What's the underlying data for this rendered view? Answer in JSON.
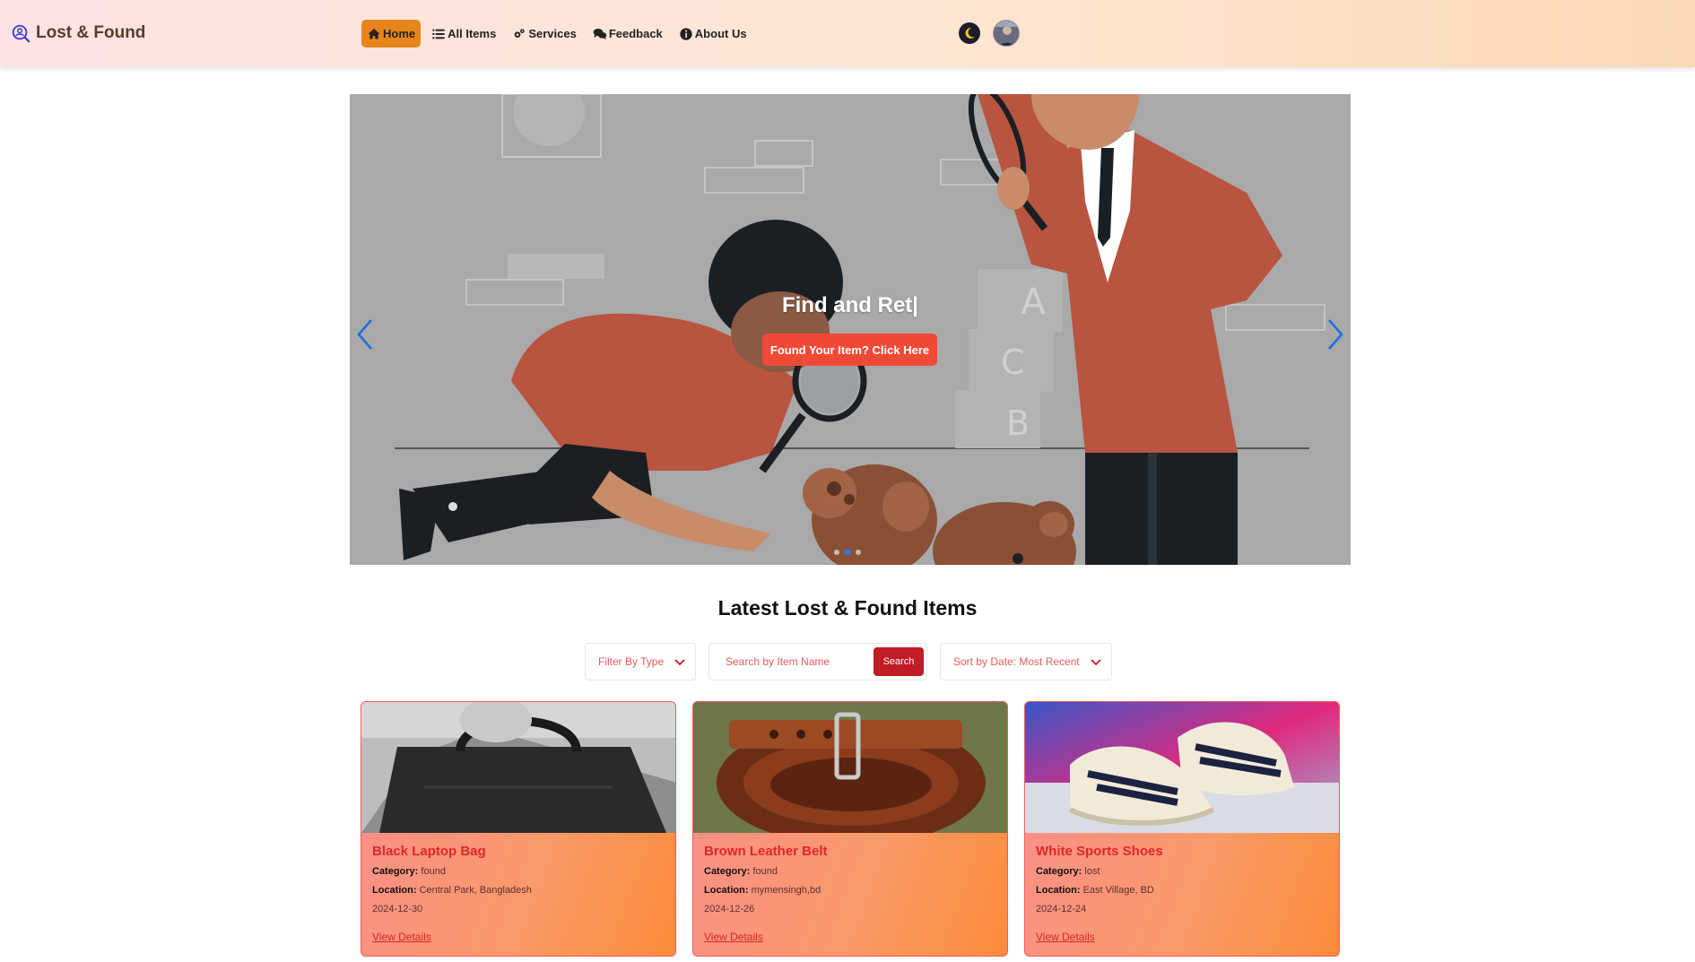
{
  "app": {
    "brand": "Lost & Found",
    "colors": {
      "accent": "#e8851a",
      "cta": "#f04a37",
      "danger": "#c01c24",
      "title_red": "#e0262c"
    }
  },
  "nav": {
    "items": [
      {
        "label": "Home",
        "icon": "home-icon",
        "active": true
      },
      {
        "label": "All Items",
        "icon": "list-icon",
        "active": false
      },
      {
        "label": "Services",
        "icon": "gears-icon",
        "active": false
      },
      {
        "label": "Feedback",
        "icon": "comments-icon",
        "active": false
      },
      {
        "label": "About Us",
        "icon": "info-icon",
        "active": false
      }
    ],
    "theme_toggle_icon": "moon-icon",
    "avatar_icon": "user-avatar"
  },
  "hero": {
    "title": "Find and Ret|",
    "cta_label": "Found Your Item? Click Here",
    "prev_icon": "chevron-left-icon",
    "next_icon": "chevron-right-icon",
    "slide_count": 3,
    "active_slide": 1
  },
  "latest": {
    "title": "Latest Lost & Found Items",
    "filter_type_label": "Filter By Type",
    "search_placeholder": "Search by Item Name",
    "search_button": "Search",
    "sort_label": "Sort by Date: Most Recent"
  },
  "items": [
    {
      "title": "Black Laptop Bag",
      "category_label": "Category:",
      "category": "found",
      "location_label": "Location:",
      "location": "Central Park, Bangladesh",
      "date": "2024-12-30",
      "link": "View Details"
    },
    {
      "title": "Brown Leather Belt",
      "category_label": "Category:",
      "category": "found",
      "location_label": "Location:",
      "location": "mymensingh,bd",
      "date": "2024-12-26",
      "link": "View Details"
    },
    {
      "title": "White Sports Shoes",
      "category_label": "Category:",
      "category": "lost",
      "location_label": "Location:",
      "location": "East Village, BD",
      "date": "2024-12-24",
      "link": "View Details"
    }
  ]
}
